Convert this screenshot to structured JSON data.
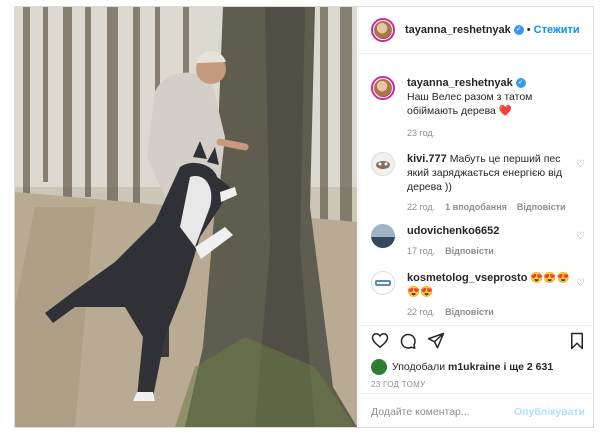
{
  "post": {
    "author": "tayanna_reshetnyak",
    "follow_label": "Стежити",
    "caption": "Наш Велес разом з татом обіймають дерева",
    "caption_emoji": "❤️",
    "caption_time": "23 год."
  },
  "comments": [
    {
      "user": "kivi.777",
      "text": "Мабуть це перший пес який заряджається енергією від дерева ))",
      "time": "22 год.",
      "likes": "1 вподобання",
      "reply": "Відповісти"
    },
    {
      "user": "udovichenko6652",
      "text": "",
      "time": "17 год.",
      "reply": "Відповісти"
    },
    {
      "user": "kosmetolog_vseprosto",
      "text": "😍😍😍😍😍",
      "time": "22 год.",
      "reply": "Відповісти"
    }
  ],
  "likes": {
    "prefix": "Уподобали",
    "user": "m1ukraine",
    "suffix": "і ще 2 631"
  },
  "post_date": "23 ГОД ТОМУ",
  "add_comment": {
    "placeholder": "Додайте коментар...",
    "post_label": "Опублікувати"
  },
  "icons": [
    "heart-icon",
    "comment-icon",
    "share-icon",
    "bookmark-icon",
    "verified-icon"
  ],
  "colors": {
    "accent": "#0095f6",
    "caption_heart": "#ed4956"
  }
}
